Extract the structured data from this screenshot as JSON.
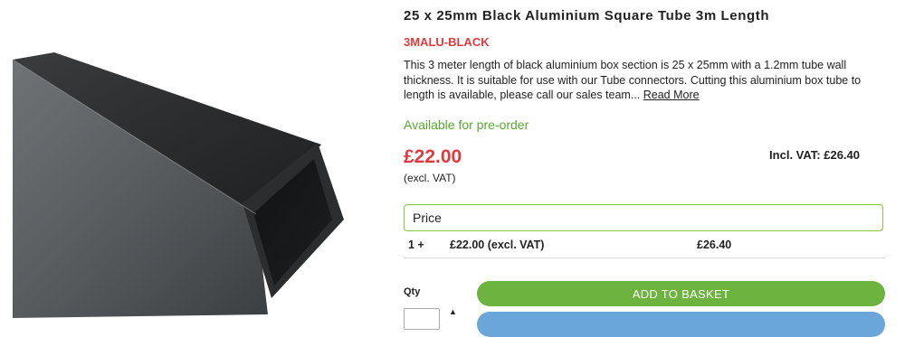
{
  "product": {
    "title": "25 x 25mm Black Aluminium Square Tube 3m Length",
    "sku": "3MALU-BLACK",
    "description": "This 3 meter length of black aluminium box section is 25 x 25mm with a 1.2mm tube wall thickness. It is suitable for use with our Tube connectors. Cutting this aluminium box tube to length is available, please call our sales team...",
    "read_more_label": "Read More",
    "availability": "Available for pre-order",
    "price": "£22.00",
    "price_note": "(excl. VAT)",
    "incl_vat": "Incl. VAT: £26.40",
    "image_icon": "black-square-aluminium-tube-image"
  },
  "pricing_table": {
    "header": "Price",
    "rows": [
      {
        "qty": "1 +",
        "price_excl": "£22.00 (excl. VAT)",
        "price_incl": "£26.40"
      }
    ]
  },
  "purchase": {
    "qty_label": "Qty",
    "qty_value": "",
    "qty_up_icon": "▲",
    "add_to_basket_label": "ADD TO BASKET"
  },
  "colors": {
    "accent_red": "#e03a3e",
    "available_green": "#5aa832",
    "button_green": "#6cb33f",
    "box_border_green": "#8cc63f",
    "secondary_blue": "#6aa6d9"
  }
}
